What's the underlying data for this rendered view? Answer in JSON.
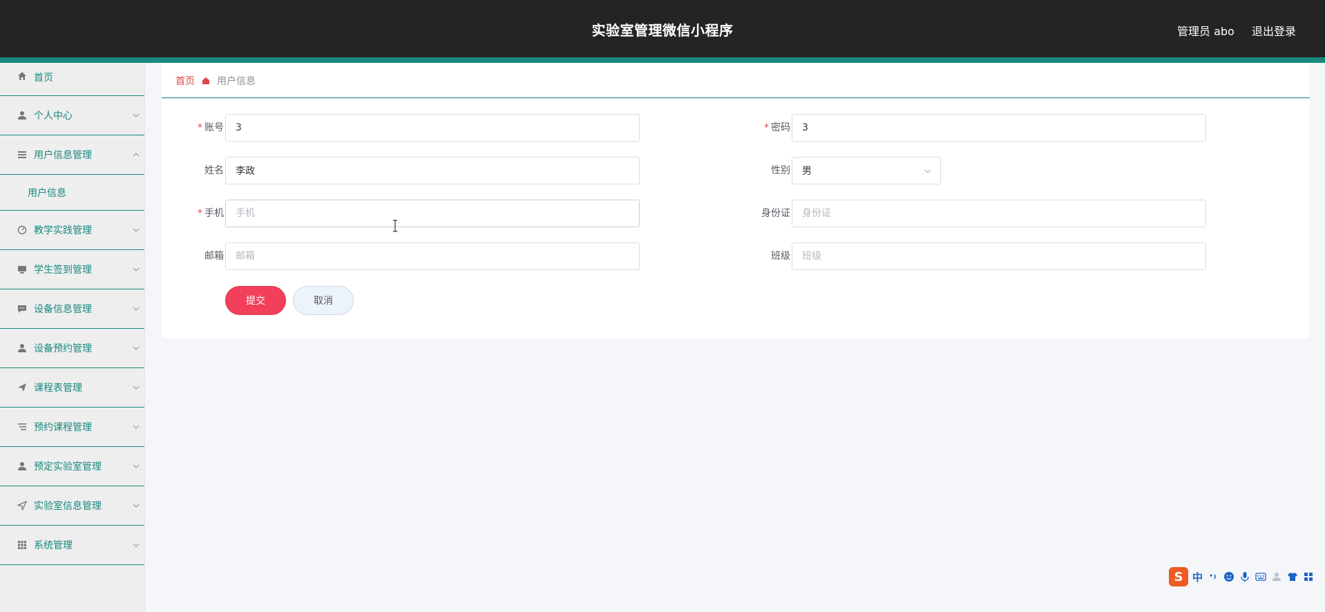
{
  "header": {
    "title": "实验室管理微信小程序",
    "user": "管理员 abo",
    "logout": "退出登录"
  },
  "sidebar": {
    "items": [
      {
        "label": "首页",
        "icon": "home-icon"
      },
      {
        "label": "个人中心",
        "icon": "user-icon"
      },
      {
        "label": "用户信息管理",
        "icon": "list-icon",
        "expanded": true,
        "sub": [
          "用户信息"
        ]
      },
      {
        "label": "教学实践管理",
        "icon": "dashboard-icon"
      },
      {
        "label": "学生签到管理",
        "icon": "monitor-icon"
      },
      {
        "label": "设备信息管理",
        "icon": "chat-icon"
      },
      {
        "label": "设备预约管理",
        "icon": "user-icon"
      },
      {
        "label": "课程表管理",
        "icon": "send-icon"
      },
      {
        "label": "预约课程管理",
        "icon": "sort-icon"
      },
      {
        "label": "预定实验室管理",
        "icon": "user-icon"
      },
      {
        "label": "实验室信息管理",
        "icon": "navigation-icon"
      },
      {
        "label": "系统管理",
        "icon": "grid-icon"
      }
    ]
  },
  "breadcrumb": {
    "home": "首页",
    "current": "用户信息"
  },
  "form": {
    "account": {
      "label": "账号",
      "value": "3",
      "required": true
    },
    "password": {
      "label": "密码",
      "value": "3",
      "required": true
    },
    "name": {
      "label": "姓名",
      "value": "李政"
    },
    "gender": {
      "label": "性别",
      "value": "男"
    },
    "phone": {
      "label": "手机",
      "placeholder": "手机",
      "required": true
    },
    "idcard": {
      "label": "身份证",
      "placeholder": "身份证"
    },
    "email": {
      "label": "邮箱",
      "placeholder": "邮箱"
    },
    "class": {
      "label": "班级",
      "placeholder": "班级"
    },
    "submit": "提交",
    "cancel": "取消"
  },
  "ime": {
    "logo": "S",
    "lang": "中"
  },
  "colors": {
    "header_bg": "#242424",
    "accent": "#17897e",
    "danger": "#f2405a",
    "sidebar_bg": "#eeeeee"
  }
}
